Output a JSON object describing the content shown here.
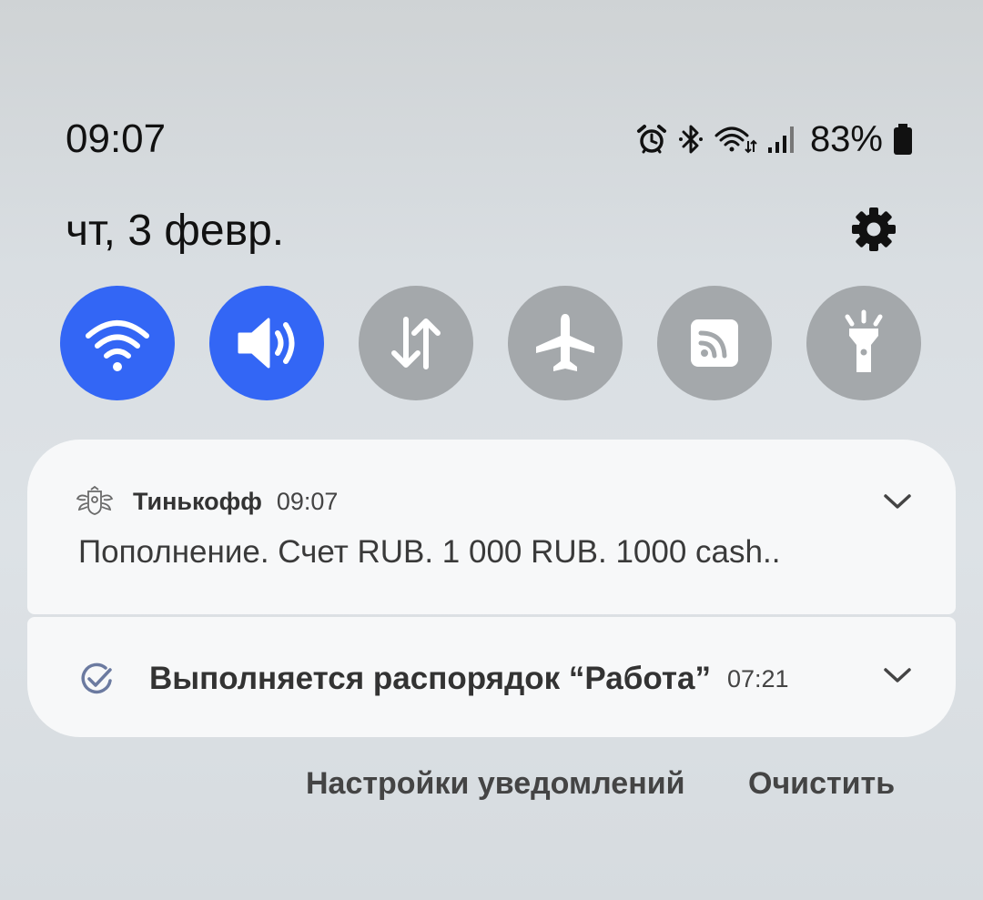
{
  "status_bar": {
    "time": "09:07",
    "battery_percent": "83%",
    "icons": [
      "alarm-icon",
      "bluetooth-icon",
      "wifi-data-icon",
      "signal-icon",
      "battery-icon"
    ]
  },
  "panel": {
    "date": "чт, 3 февр.",
    "settings_icon": "gear-icon"
  },
  "quick_settings": [
    {
      "name": "wifi",
      "icon": "wifi-icon",
      "active": true
    },
    {
      "name": "sound",
      "icon": "speaker-icon",
      "active": true
    },
    {
      "name": "mobile-data",
      "icon": "data-arrows-icon",
      "active": false
    },
    {
      "name": "airplane-mode",
      "icon": "airplane-icon",
      "active": false
    },
    {
      "name": "nfc",
      "icon": "nfc-icon",
      "active": false
    },
    {
      "name": "flashlight",
      "icon": "flashlight-icon",
      "active": false
    }
  ],
  "notifications": [
    {
      "app": "Тинькофф",
      "time": "09:07",
      "text": "Пополнение. Счет RUB. 1 000 RUB. 1000 cash..",
      "icon": "tinkoff-icon"
    },
    {
      "title": "Выполняется распорядок “Работа”",
      "time": "07:21",
      "icon": "routine-check-icon"
    }
  ],
  "actions": {
    "notification_settings": "Настройки уведомлений",
    "clear": "Очистить"
  },
  "colors": {
    "active_toggle": "#3366f5",
    "inactive_toggle": "#a4a8ab",
    "card_background": "#f7f8f9"
  }
}
